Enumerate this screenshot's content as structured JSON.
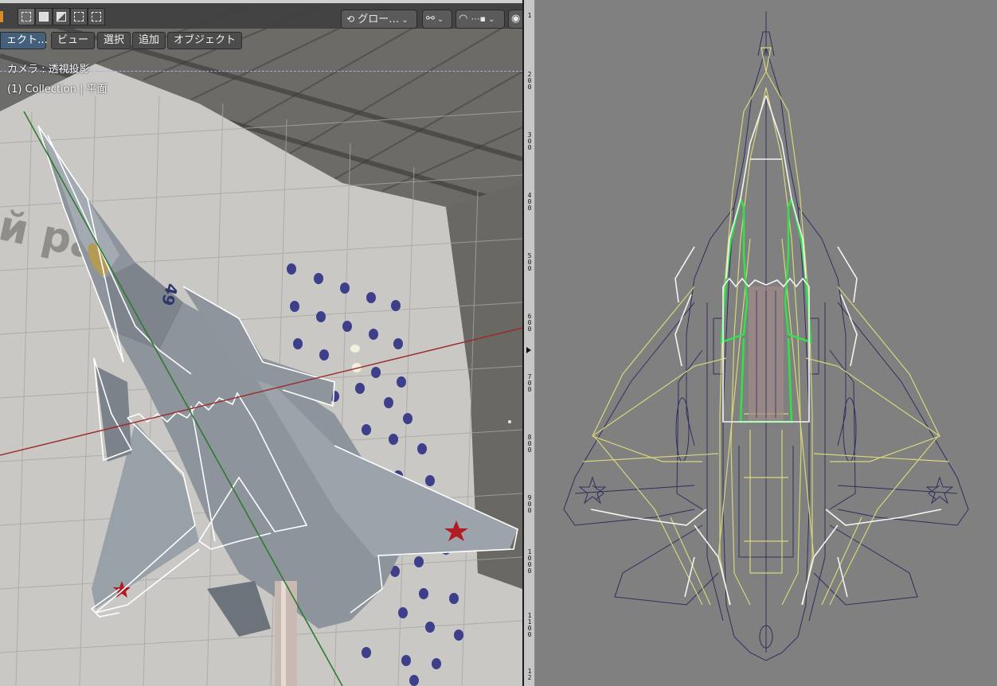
{
  "header": {
    "transform_orientation": "グロー…",
    "select_modes": [
      "new",
      "extend",
      "subtract",
      "invert",
      "intersect"
    ]
  },
  "menu": {
    "mode_label": "ェクト…",
    "items": [
      "ビュー",
      "選択",
      "追加",
      "オブジェクト"
    ]
  },
  "viewport_overlay": {
    "camera_label": "カメラ : 透視投影",
    "collection_label": "(1) Collection | 平面"
  },
  "scene": {
    "aircraft_number": "49",
    "hangar_banner_text": "й ра"
  },
  "ruler": {
    "labels": [
      "1",
      "2 0 0",
      "3 0 0",
      "4 0 0",
      "5 0 0",
      "6 0 0",
      "7 0 0",
      "8 0 0",
      "9 0 0",
      "1 0 0 0",
      "1 1 0 0",
      "1 2"
    ]
  },
  "icons": {
    "orientation": "transform-orientation-icon",
    "pivot": "pivot-link-icon",
    "snap": "snap-magnet-icon",
    "snap_target": "snap-increment-icon",
    "proportional": "proportional-edit-icon"
  },
  "colors": {
    "header_bg": "#404040",
    "mode_button": "#44607a",
    "x_axis": "#9a2a2a",
    "y_axis": "#2f7a2f",
    "reference_bg": "#808080",
    "wire_yellow": "#d8d67a",
    "wire_green": "#34e04a",
    "wire_navy": "#2e2f5c"
  }
}
